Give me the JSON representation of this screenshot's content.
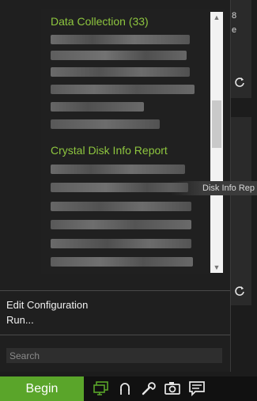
{
  "menu": {
    "list": {
      "group1_header": "Data Collection (33)",
      "group2_header": "Crystal Disk Info Report"
    },
    "tooltip_text": "Disk Info Rep",
    "commands": {
      "edit_configuration": "Edit Configuration",
      "run": "Run..."
    },
    "search": {
      "placeholder": "Search"
    }
  },
  "side": {
    "count_digit": "8",
    "letter": "e"
  },
  "taskbar": {
    "begin_label": "Begin",
    "icons": [
      "monitor-icon",
      "headset-icon",
      "wrench-icon",
      "camera-icon",
      "chat-icon"
    ],
    "accent_color": "#5aa52a",
    "icon_color": "#5aa52a"
  },
  "colors": {
    "group_header": "#8ec63f",
    "menu_background": "#1f1f1f"
  }
}
